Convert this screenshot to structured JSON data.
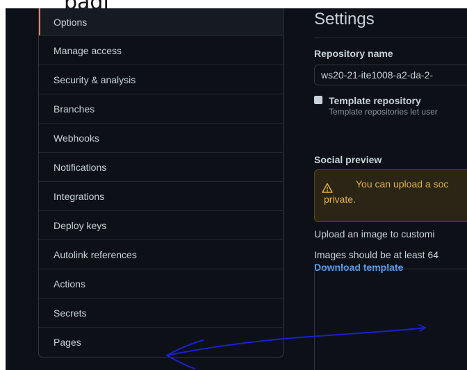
{
  "header_fragment": "pagi",
  "sidebar": {
    "items": [
      {
        "label": "Options",
        "active": true
      },
      {
        "label": "Manage access"
      },
      {
        "label": "Security & analysis"
      },
      {
        "label": "Branches"
      },
      {
        "label": "Webhooks"
      },
      {
        "label": "Notifications"
      },
      {
        "label": "Integrations"
      },
      {
        "label": "Deploy keys"
      },
      {
        "label": "Autolink references"
      },
      {
        "label": "Actions"
      },
      {
        "label": "Secrets"
      },
      {
        "label": "Pages"
      }
    ]
  },
  "main": {
    "title": "Settings",
    "repo_name_label": "Repository name",
    "repo_name_value": "ws20-21-ite1008-a2-da-2-",
    "template_label": "Template repository",
    "template_note": "Template repositories let user",
    "social_preview_label": "Social preview",
    "warning_text": "You can upload a soc\nprivate.",
    "upload_text": "Upload an image to customi",
    "images_text": "Images should be at least 64",
    "download_link": "Download template"
  },
  "colors": {
    "background": "#0d1117",
    "text": "#c9d1d9",
    "active_indicator": "#f78166",
    "warning_text": "#e3b341",
    "link": "#58a6ff",
    "annotation_ink": "#1a1fd6"
  },
  "icons": {
    "warning": "alert-triangle-icon"
  }
}
